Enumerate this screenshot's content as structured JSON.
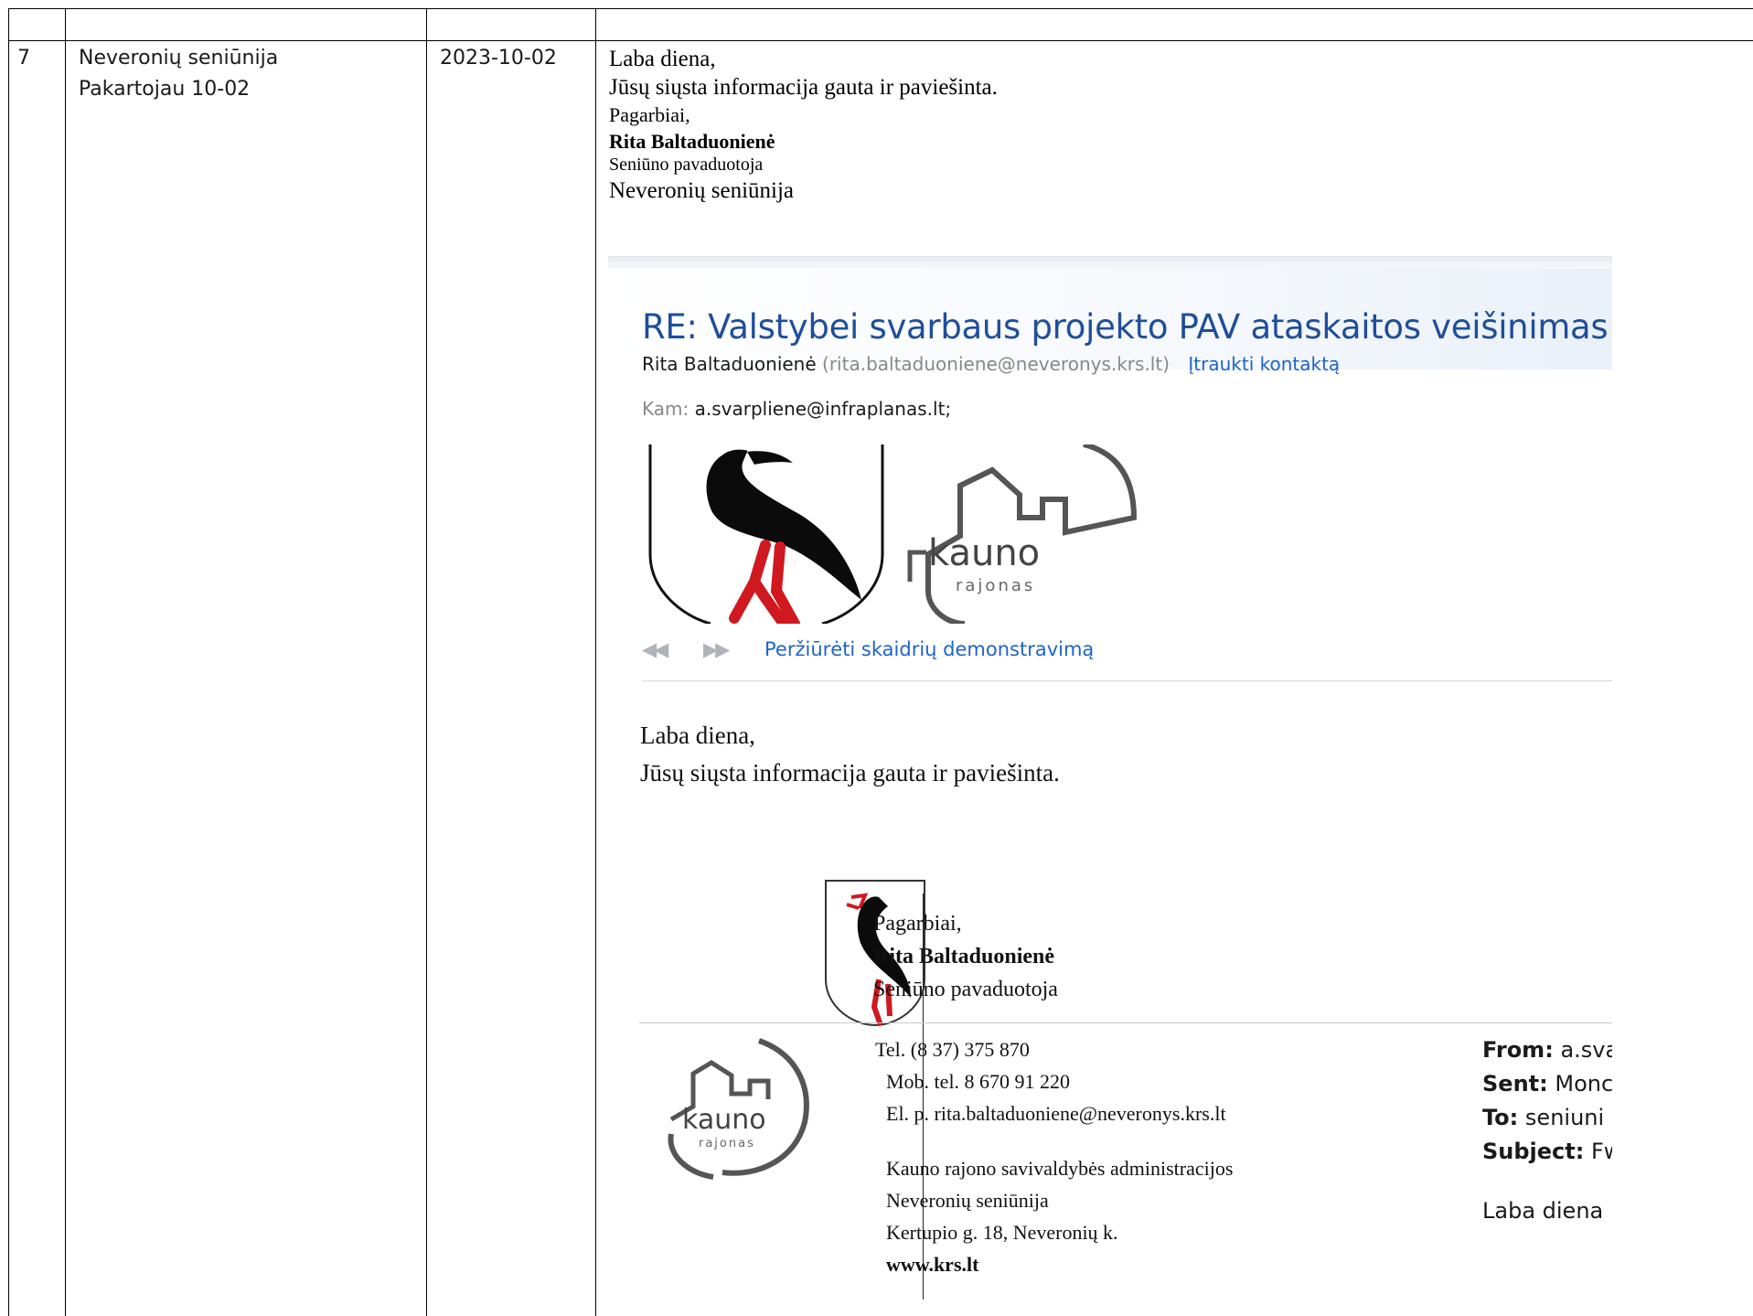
{
  "row": {
    "number": "7",
    "org_line1": "Neveronių seniūnija",
    "org_line2": "Pakartojau 10-02",
    "date": "2023-10-02"
  },
  "letter": {
    "greeting": "Laba diena,",
    "line2": "Jūsų siųsta informacija gauta ir paviešinta.",
    "regards": "Pagarbiai,",
    "name": "Rita Baltaduonienė",
    "position": "Seniūno pavaduotoja",
    "org": "Neveronių seniūnija"
  },
  "email": {
    "subject": "RE: Valstybei svarbaus projekto PAV ataskaitos veišinimas",
    "sender_name": "Rita Baltaduonienė",
    "sender_email": "(rita.baltaduoniene@neveronys.krs.lt)",
    "add_contact": "Įtraukti kontaktą",
    "to_label": "Kam:",
    "to_value": "a.svarpliene@infraplanas.lt;",
    "slideshow_label": "Peržiūrėti skaidrių demonstravimą",
    "logo_word": "kauno",
    "logo_subword": "rajonas",
    "body_greeting": "Laba diena,",
    "body_line": "Jūsų siųsta informacija gauta ir paviešinta.",
    "sig_regards": "Pagarbiai,",
    "sig_name": "Rita Baltaduonienė",
    "sig_position": "Seniūno pavaduotoja",
    "tel": "Tel. (8 37) 375 870",
    "mob": "Mob. tel. 8 670 91 220",
    "el": "El. p. rita.baltaduoniene@neveronys.krs.lt",
    "addr1": "Kauno rajono savivaldybės administracijos",
    "addr2": "Neveronių seniūnija",
    "addr3": "Kertupio g. 18, Neveronių k.",
    "web": "www.krs.lt",
    "from_label": "From:",
    "from_value": "a.sva",
    "sent_label": "Sent:",
    "sent_value": "Monc",
    "to2_label": "To:",
    "to2_value": "seniuni",
    "subject_label": "Subject:",
    "subject_value": "Fw",
    "body2_greeting": "Laba diena"
  },
  "colors": {
    "subject": "#1f4e9a",
    "link": "#1e64c8",
    "stork_red": "#d0181f"
  }
}
